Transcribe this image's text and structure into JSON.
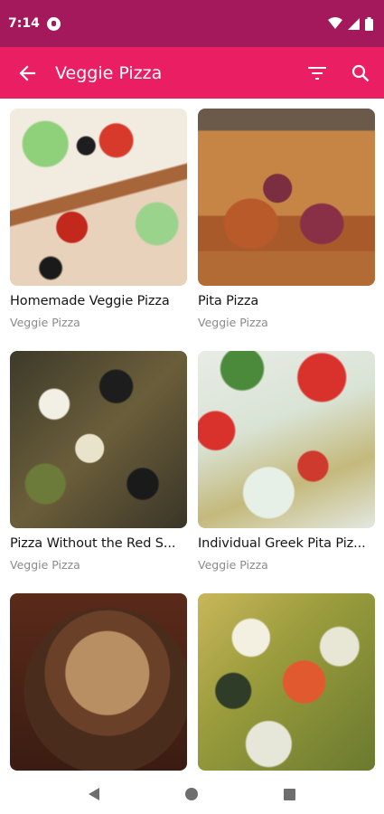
{
  "status_bar": {
    "time": "7:14",
    "icons": [
      "notification-icon",
      "wifi-icon",
      "signal-icon",
      "battery-icon"
    ]
  },
  "app_bar": {
    "title": "Veggie Pizza",
    "back_icon": "arrow-back-icon",
    "actions": [
      "filter-icon",
      "search-icon"
    ],
    "color": "#e91e63",
    "status_color": "#a3195b"
  },
  "recipes": [
    {
      "title": "Homemade Veggie Pizza",
      "category": "Veggie Pizza"
    },
    {
      "title": "Pita Pizza",
      "category": "Veggie Pizza"
    },
    {
      "title": "Pizza Without the Red S...",
      "category": "Veggie Pizza"
    },
    {
      "title": "Individual Greek Pita Piz...",
      "category": "Veggie Pizza"
    },
    {
      "title": "",
      "category": ""
    },
    {
      "title": "",
      "category": ""
    }
  ],
  "nav_bar": {
    "buttons": [
      "nav-back-icon",
      "nav-home-icon",
      "nav-recents-icon"
    ]
  }
}
